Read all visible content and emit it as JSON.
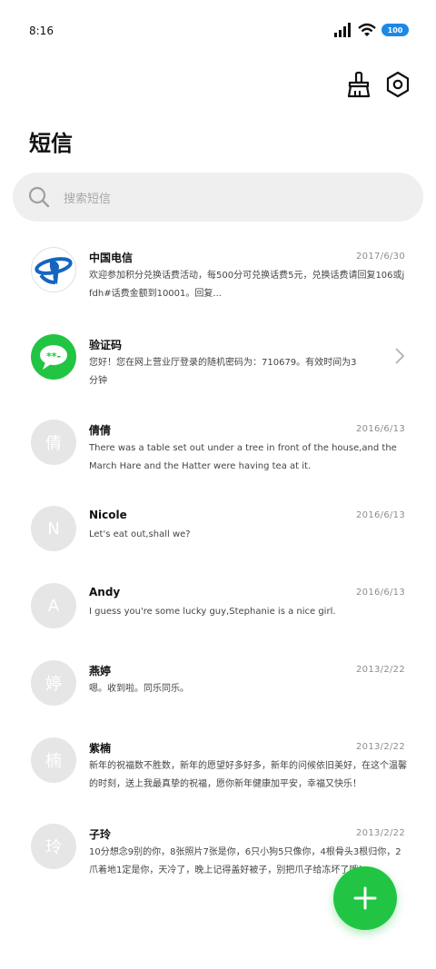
{
  "status_bar": {
    "time": "8:16",
    "battery": "100",
    "battery_color": "#1e88e5"
  },
  "header": {
    "title": "短信",
    "icons": [
      "brush-icon",
      "settings-icon"
    ]
  },
  "search": {
    "placeholder": "搜索短信"
  },
  "accent_color": "#22c543",
  "messages": [
    {
      "avatar_type": "china-telecom-logo",
      "sender": "中国电信",
      "date": "2017/6/30",
      "preview": "欢迎参加积分兑换话费活动，每500分可兑换话费5元，兑换话费请回复106或jfdh#话费金额到10001。回复..."
    },
    {
      "avatar_type": "sms-icon",
      "sender": "验证码",
      "date": "",
      "preview": "您好！您在网上营业厅登录的随机密码为：710679。有效时间为3分钟"
    },
    {
      "avatar_type": "initial",
      "avatar_text": "倩",
      "sender": "倩倩",
      "date": "2016/6/13",
      "preview": "There was a table set out under a tree in front of the house,and the March Hare and the Hatter were having tea at it."
    },
    {
      "avatar_type": "initial",
      "avatar_text": "N",
      "sender": "Nicole",
      "date": "2016/6/13",
      "preview": "Let's eat out,shall we?"
    },
    {
      "avatar_type": "initial",
      "avatar_text": "A",
      "sender": "Andy",
      "date": "2016/6/13",
      "preview": "I guess you're some lucky guy,Stephanie is a nice girl."
    },
    {
      "avatar_type": "initial",
      "avatar_text": "婷",
      "sender": "燕婷",
      "date": "2013/2/22",
      "preview": "嗯。收到啦。同乐同乐。"
    },
    {
      "avatar_type": "initial",
      "avatar_text": "楠",
      "sender": "紫楠",
      "date": "2013/2/22",
      "preview": "新年的祝福数不胜数，新年的愿望好多好多，新年的问候依旧美好，在这个温馨的时刻，送上我最真挚的祝福，愿你新年健康加平安，幸福又快乐！"
    },
    {
      "avatar_type": "initial",
      "avatar_text": "玲",
      "sender": "子玲",
      "date": "2013/2/22",
      "preview": "10分想念9别的你，8张照片7张是你，6只小狗5只像你，4根骨头3根归你，2爪着地1定是你，天冷了，晚上记得盖好被子，别把爪子给冻坏了哦！"
    }
  ]
}
